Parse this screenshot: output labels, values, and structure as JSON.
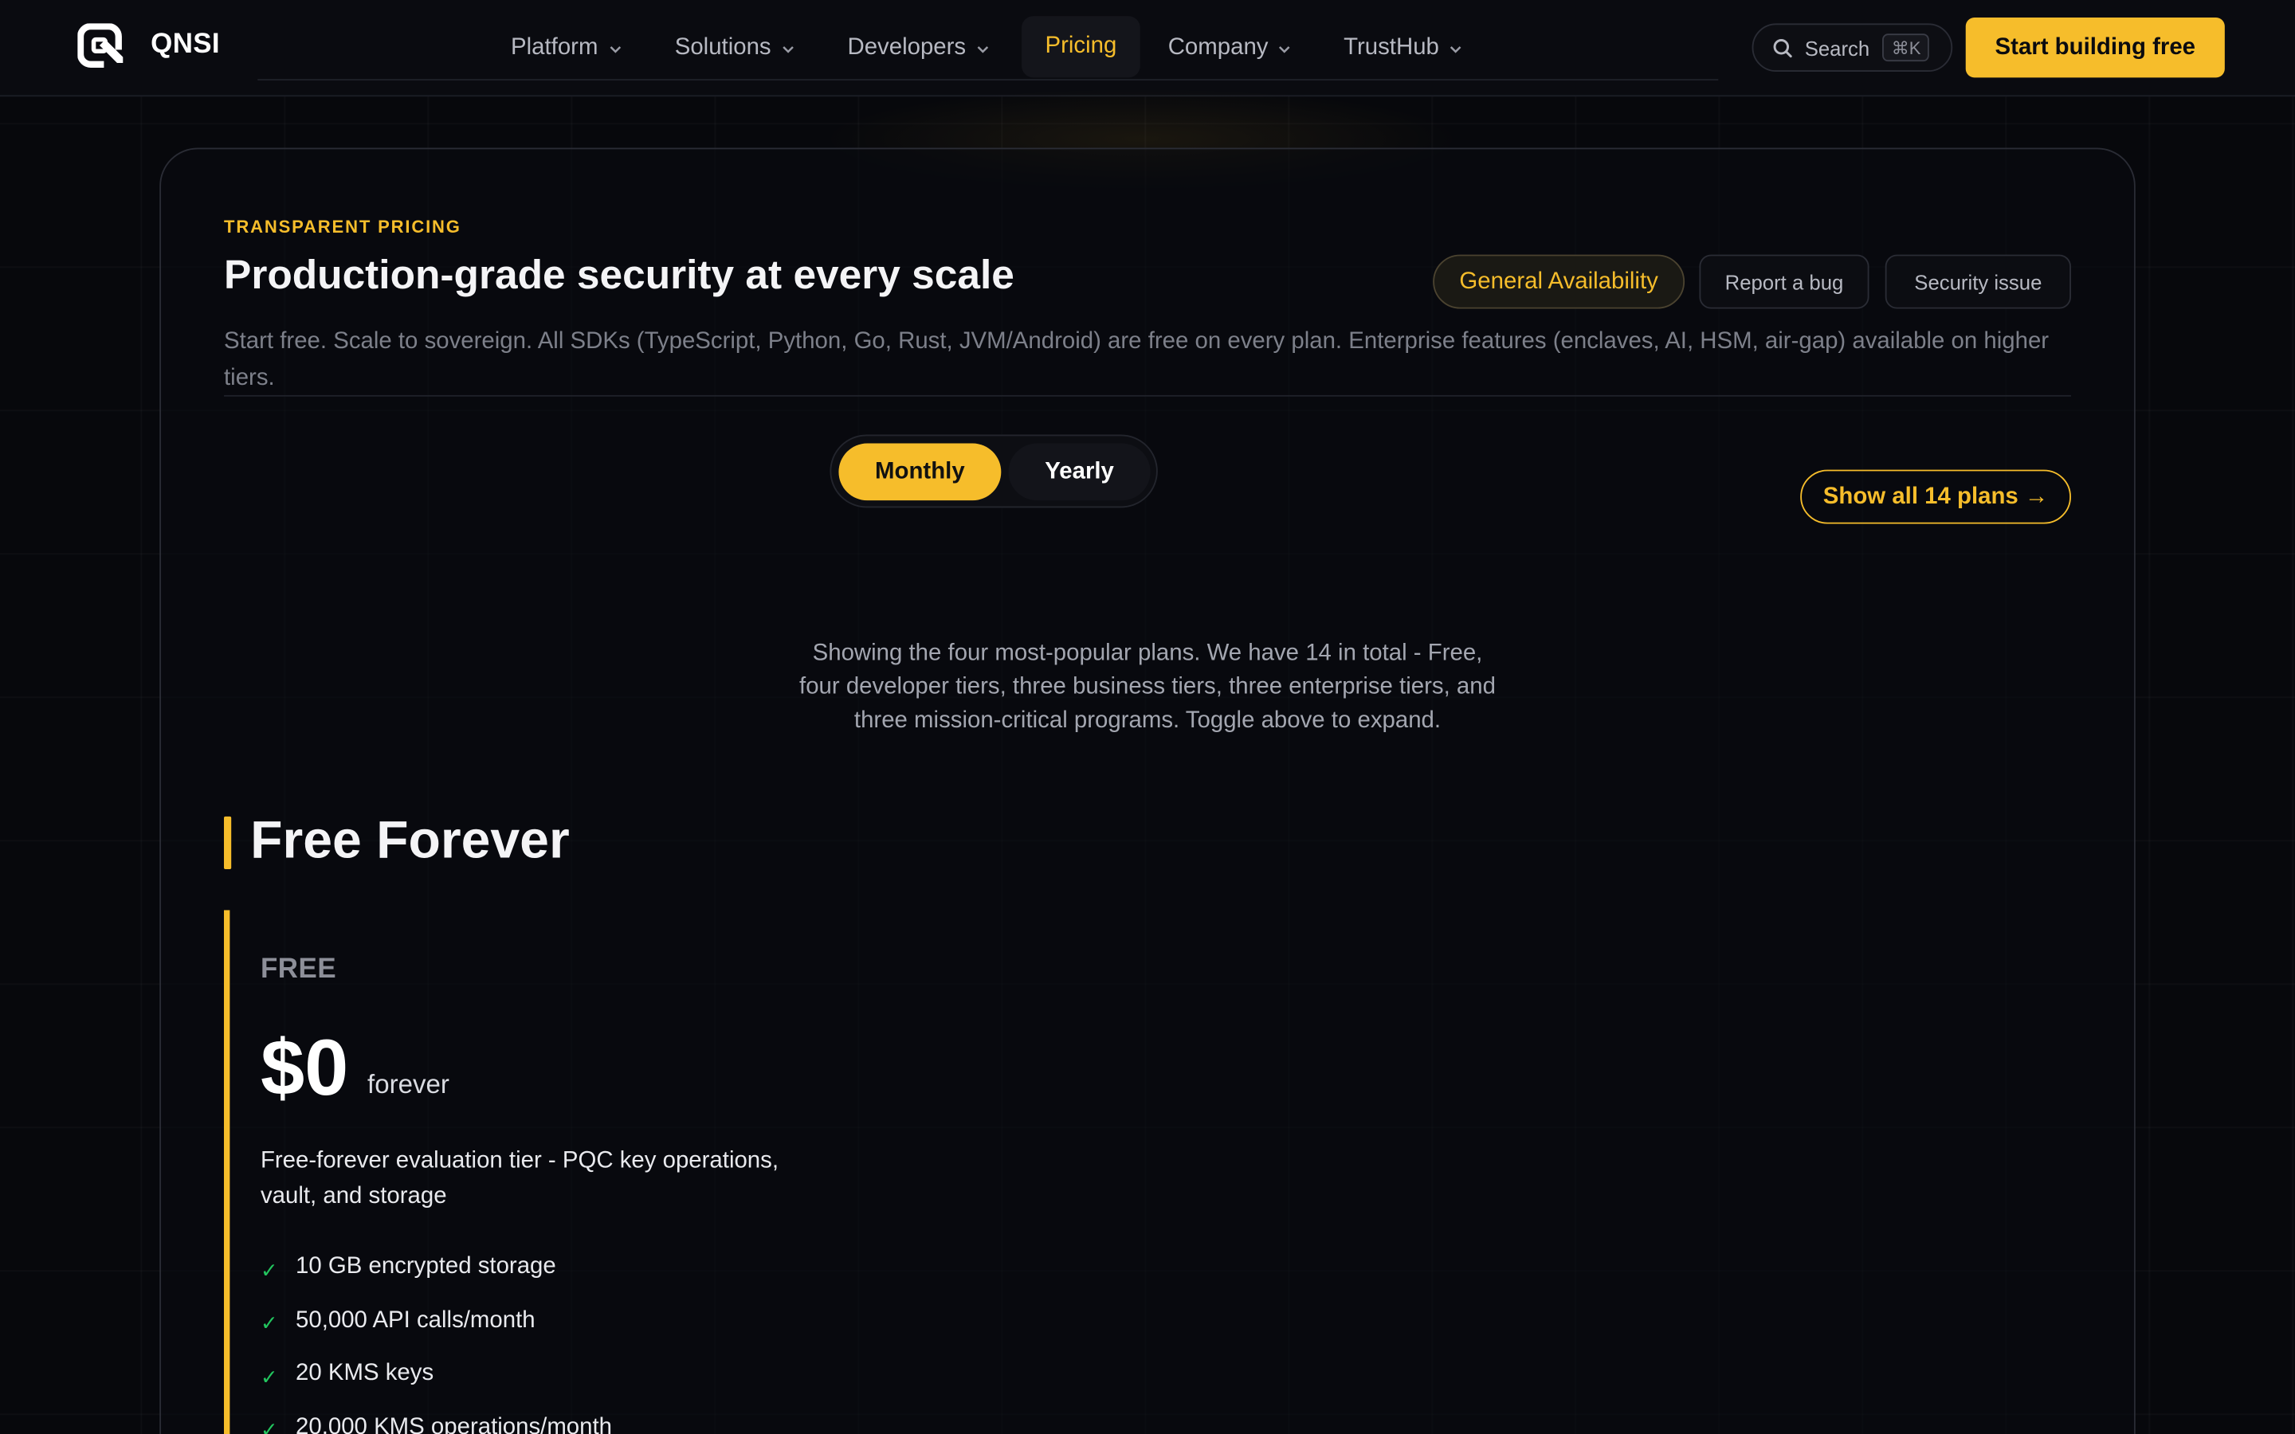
{
  "nav": {
    "brand": "QNSI",
    "items": [
      {
        "label": "Platform"
      },
      {
        "label": "Solutions"
      },
      {
        "label": "Developers"
      },
      {
        "label": "Pricing"
      },
      {
        "label": "Company"
      },
      {
        "label": "TrustHub"
      }
    ],
    "search_label": "Search",
    "search_shortcut": "⌘K",
    "cta_label": "Start building free"
  },
  "hero": {
    "eyebrow": "TRANSPARENT PRICING",
    "title": "Production-grade security at every scale",
    "subtitle": "Start free. Scale to sovereign. All SDKs (TypeScript, Python, Go, Rust, JVM/Android) are free on every plan. Enterprise features (enclaves, AI, HSM, air-gap) available on higher tiers.",
    "pills": {
      "general_availability": "General Availability",
      "report_bug": "Report a bug",
      "security_issue": "Security issue"
    }
  },
  "billing_toggle": {
    "monthly": "Monthly",
    "yearly": "Yearly",
    "selected": "Monthly"
  },
  "show_all_label": "Show all 14 plans →",
  "showing_text": "Showing the four most-popular plans. We have 14 in total - Free, four developer tiers, three business tiers, three enterprise tiers, and three mission-critical programs. Toggle above to expand.",
  "free_section": {
    "title": "Free Forever",
    "plan": {
      "tier": "FREE",
      "price": "$0",
      "period": "forever",
      "description": "Free-forever evaluation tier - PQC key operations, vault, and storage",
      "features": [
        "10 GB encrypted storage",
        "50,000 API calls/month",
        "20 KMS keys",
        "20,000 KMS operations/month"
      ]
    }
  },
  "colors": {
    "accent": "#f6bd2b",
    "background": "#07080c",
    "check": "#22c55e"
  }
}
